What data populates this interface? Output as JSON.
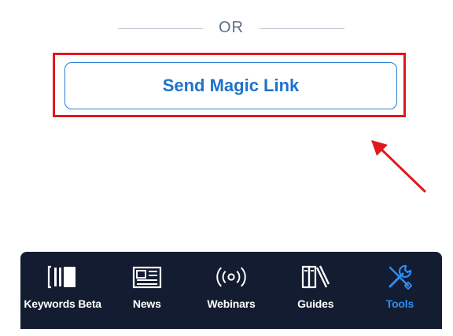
{
  "divider": {
    "text": "OR"
  },
  "magic_link": {
    "label": "Send Magic Link"
  },
  "colors": {
    "accent": "#1f72c9",
    "highlight": "#e0191e",
    "tabbar_bg": "#141c32",
    "tab_active": "#2d8df0"
  },
  "tabbar": {
    "items": [
      {
        "label": "Keywords Beta",
        "icon": "keywords-icon",
        "active": false
      },
      {
        "label": "News",
        "icon": "newspaper-icon",
        "active": false
      },
      {
        "label": "Webinars",
        "icon": "broadcast-icon",
        "active": false
      },
      {
        "label": "Guides",
        "icon": "books-icon",
        "active": false
      },
      {
        "label": "Tools",
        "icon": "tools-icon",
        "active": true
      }
    ]
  }
}
